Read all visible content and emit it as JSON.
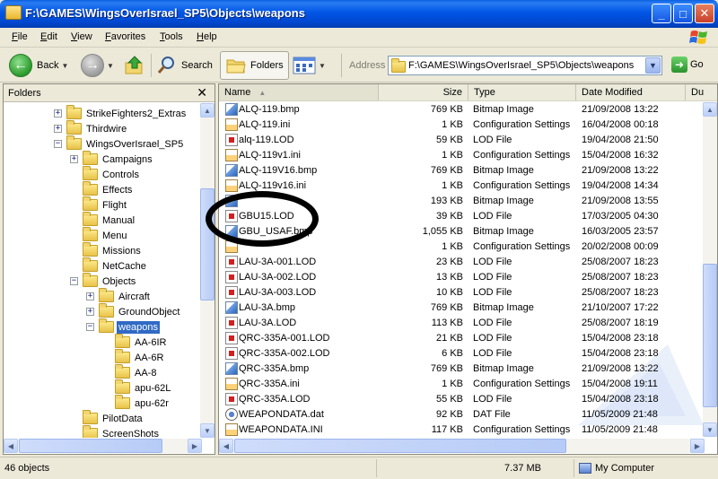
{
  "window": {
    "title": "F:\\GAMES\\WingsOverIsrael_SP5\\Objects\\weapons",
    "minimize": "_",
    "maximize": "□",
    "close": "✕"
  },
  "menu": {
    "items": [
      {
        "first": "F",
        "rest": "ile"
      },
      {
        "first": "E",
        "rest": "dit"
      },
      {
        "first": "V",
        "rest": "iew"
      },
      {
        "first": "F",
        "rest": "avorites"
      },
      {
        "first": "T",
        "rest": "ools"
      },
      {
        "first": "H",
        "rest": "elp"
      }
    ]
  },
  "toolbar": {
    "back_label": "Back",
    "search_label": "Search",
    "folders_label": "Folders"
  },
  "address": {
    "label": "Address",
    "value": "F:\\GAMES\\WingsOverIsrael_SP5\\Objects\\weapons",
    "go_label": "Go"
  },
  "folders_pane": {
    "title": "Folders",
    "close": "✕",
    "tree": [
      {
        "label": "StrikeFighters2_Extras",
        "level": 3,
        "expander": "+"
      },
      {
        "label": "Thirdwire",
        "level": 3,
        "expander": "+"
      },
      {
        "label": "WingsOverIsrael_SP5",
        "level": 3,
        "expander": "−"
      },
      {
        "label": "Campaigns",
        "level": 4,
        "expander": "+"
      },
      {
        "label": "Controls",
        "level": 4,
        "expander": ""
      },
      {
        "label": "Effects",
        "level": 4,
        "expander": ""
      },
      {
        "label": "Flight",
        "level": 4,
        "expander": ""
      },
      {
        "label": "Manual",
        "level": 4,
        "expander": ""
      },
      {
        "label": "Menu",
        "level": 4,
        "expander": ""
      },
      {
        "label": "Missions",
        "level": 4,
        "expander": ""
      },
      {
        "label": "NetCache",
        "level": 4,
        "expander": ""
      },
      {
        "label": "Objects",
        "level": 4,
        "expander": "−"
      },
      {
        "label": "Aircraft",
        "level": 5,
        "expander": "+"
      },
      {
        "label": "GroundObject",
        "level": 5,
        "expander": "+"
      },
      {
        "label": "weapons",
        "level": 5,
        "expander": "−",
        "selected": true
      },
      {
        "label": "AA-6IR",
        "level": 6,
        "expander": ""
      },
      {
        "label": "AA-6R",
        "level": 6,
        "expander": ""
      },
      {
        "label": "AA-8",
        "level": 6,
        "expander": ""
      },
      {
        "label": "apu-62L",
        "level": 6,
        "expander": ""
      },
      {
        "label": "apu-62r",
        "level": 6,
        "expander": ""
      },
      {
        "label": "PilotData",
        "level": 4,
        "expander": ""
      },
      {
        "label": "ScreenShots",
        "level": 4,
        "expander": ""
      }
    ]
  },
  "columns": {
    "name": "Name",
    "size": "Size",
    "type": "Type",
    "date": "Date Modified",
    "extra": "Du"
  },
  "files": [
    {
      "name": "ALQ-119.bmp",
      "size": "769 KB",
      "type": "Bitmap Image",
      "date": "21/09/2008 13:22",
      "icon": "bmp"
    },
    {
      "name": "ALQ-119.ini",
      "size": "1 KB",
      "type": "Configuration Settings",
      "date": "16/04/2008 00:18",
      "icon": "ini"
    },
    {
      "name": "alq-119.LOD",
      "size": "59 KB",
      "type": "LOD File",
      "date": "19/04/2008 21:50",
      "icon": "lod"
    },
    {
      "name": "ALQ-119v1.ini",
      "size": "1 KB",
      "type": "Configuration Settings",
      "date": "15/04/2008 16:32",
      "icon": "ini"
    },
    {
      "name": "ALQ-119V16.bmp",
      "size": "769 KB",
      "type": "Bitmap Image",
      "date": "21/09/2008 13:22",
      "icon": "bmp"
    },
    {
      "name": "ALQ-119v16.ini",
      "size": "1 KB",
      "type": "Configuration Settings",
      "date": "19/04/2008 14:34",
      "icon": "ini"
    },
    {
      "name": "",
      "size": "193 KB",
      "type": "Bitmap Image",
      "date": "21/09/2008 13:55",
      "icon": "bmp"
    },
    {
      "name": "GBU15.LOD",
      "size": "39 KB",
      "type": "LOD File",
      "date": "17/03/2005 04:30",
      "icon": "lod"
    },
    {
      "name": "GBU_USAF.bmp",
      "size": "1,055 KB",
      "type": "Bitmap Image",
      "date": "16/03/2005 23:57",
      "icon": "bmp"
    },
    {
      "name": "",
      "size": "1 KB",
      "type": "Configuration Settings",
      "date": "20/02/2008 00:09",
      "icon": "ini"
    },
    {
      "name": "LAU-3A-001.LOD",
      "size": "23 KB",
      "type": "LOD File",
      "date": "25/08/2007 18:23",
      "icon": "lod"
    },
    {
      "name": "LAU-3A-002.LOD",
      "size": "13 KB",
      "type": "LOD File",
      "date": "25/08/2007 18:23",
      "icon": "lod"
    },
    {
      "name": "LAU-3A-003.LOD",
      "size": "10 KB",
      "type": "LOD File",
      "date": "25/08/2007 18:23",
      "icon": "lod"
    },
    {
      "name": "LAU-3A.bmp",
      "size": "769 KB",
      "type": "Bitmap Image",
      "date": "21/10/2007 17:22",
      "icon": "bmp"
    },
    {
      "name": "LAU-3A.LOD",
      "size": "113 KB",
      "type": "LOD File",
      "date": "25/08/2007 18:19",
      "icon": "lod"
    },
    {
      "name": "QRC-335A-001.LOD",
      "size": "21 KB",
      "type": "LOD File",
      "date": "15/04/2008 23:18",
      "icon": "lod"
    },
    {
      "name": "QRC-335A-002.LOD",
      "size": "6 KB",
      "type": "LOD File",
      "date": "15/04/2008 23:18",
      "icon": "lod"
    },
    {
      "name": "QRC-335A.bmp",
      "size": "769 KB",
      "type": "Bitmap Image",
      "date": "21/09/2008 13:22",
      "icon": "bmp"
    },
    {
      "name": "QRC-335A.ini",
      "size": "1 KB",
      "type": "Configuration Settings",
      "date": "15/04/2008 19:11",
      "icon": "ini"
    },
    {
      "name": "QRC-335A.LOD",
      "size": "55 KB",
      "type": "LOD File",
      "date": "15/04/2008 23:18",
      "icon": "lod"
    },
    {
      "name": "WEAPONDATA.dat",
      "size": "92 KB",
      "type": "DAT File",
      "date": "11/05/2009 21:48",
      "icon": "dat"
    },
    {
      "name": "WEAPONDATA.INI",
      "size": "117 KB",
      "type": "Configuration Settings",
      "date": "11/05/2009 21:48",
      "icon": "ini"
    }
  ],
  "status": {
    "objects": "46 objects",
    "size": "7.37 MB",
    "location": "My Computer"
  }
}
